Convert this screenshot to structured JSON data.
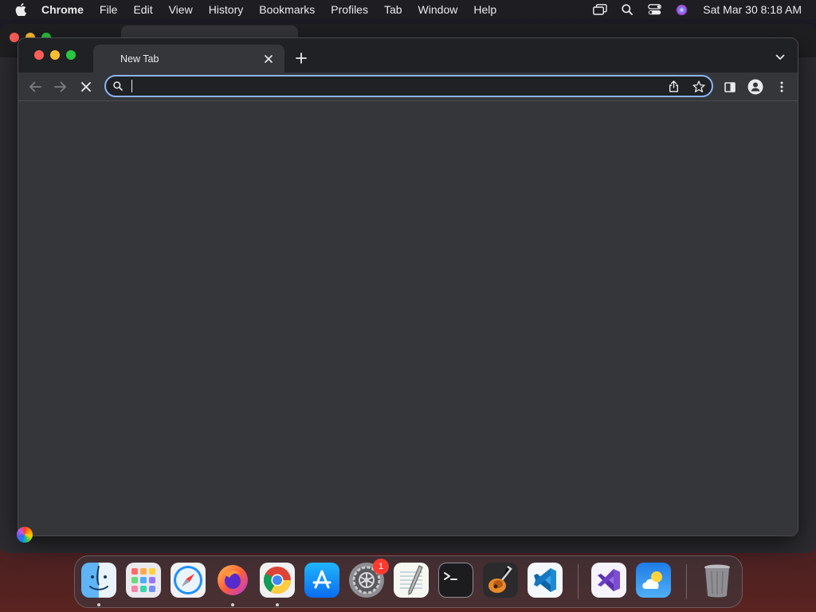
{
  "menubar": {
    "app_name": "Chrome",
    "items": [
      "File",
      "Edit",
      "View",
      "History",
      "Bookmarks",
      "Profiles",
      "Tab",
      "Window",
      "Help"
    ],
    "clock": "Sat Mar 30  8:18 AM",
    "status_icons": [
      "screen-mirroring-icon",
      "spotlight-search-icon",
      "control-center-icon",
      "siri-icon"
    ]
  },
  "browser": {
    "tab": {
      "title": "New Tab"
    },
    "omnibox": {
      "value": "",
      "placeholder": ""
    },
    "colors": {
      "focus_ring": "#8ab4f8",
      "tabstrip": "#202124",
      "toolbar": "#35363a"
    }
  },
  "dock": {
    "apps": [
      {
        "name": "Finder",
        "icon": "finder-icon",
        "running": true
      },
      {
        "name": "Launchpad",
        "icon": "launchpad-icon",
        "running": false
      },
      {
        "name": "Safari",
        "icon": "safari-icon",
        "running": false
      },
      {
        "name": "Firefox",
        "icon": "firefox-icon",
        "running": true
      },
      {
        "name": "Google Chrome",
        "icon": "chrome-icon",
        "running": true
      },
      {
        "name": "App Store",
        "icon": "app-store-icon",
        "running": false
      },
      {
        "name": "System Preferences",
        "icon": "system-preferences-icon",
        "running": false,
        "badge": "1"
      },
      {
        "name": "TextEdit",
        "icon": "textedit-icon",
        "running": false
      },
      {
        "name": "Terminal",
        "icon": "terminal-icon",
        "running": false
      },
      {
        "name": "GarageBand",
        "icon": "garageband-icon",
        "running": false
      },
      {
        "name": "Visual Studio Code",
        "icon": "vscode-icon",
        "running": false
      },
      {
        "name": "Visual Studio",
        "icon": "visual-studio-icon",
        "running": false
      },
      {
        "name": "Weather",
        "icon": "weather-icon",
        "running": false
      },
      {
        "name": "Trash",
        "icon": "trash-icon",
        "running": false
      }
    ],
    "badge_count": "1"
  }
}
